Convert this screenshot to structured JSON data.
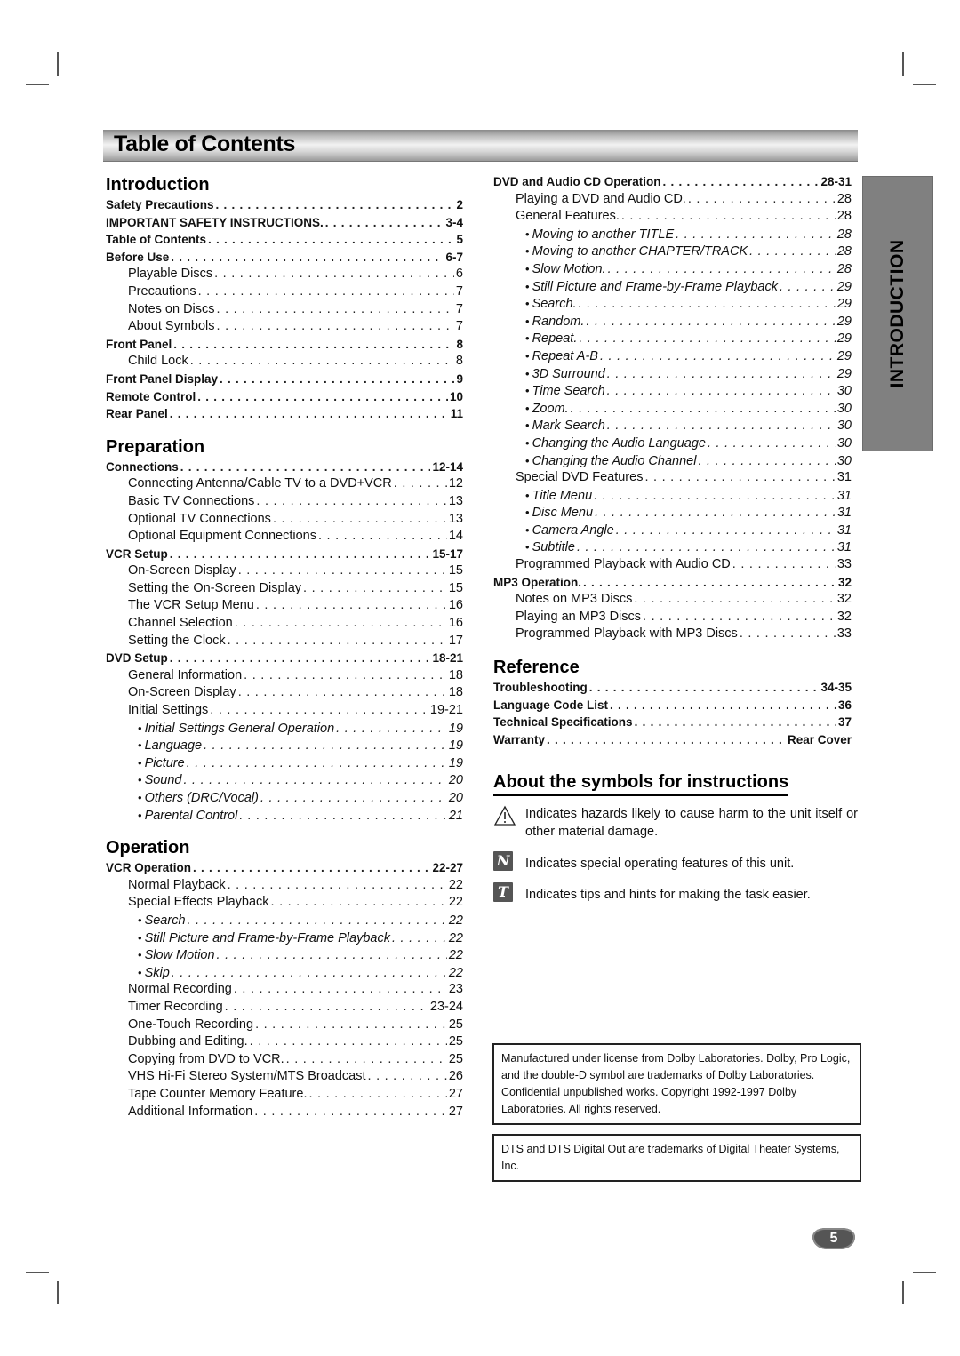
{
  "header": {
    "title": "Table of Contents"
  },
  "side_tab": {
    "label": "INTRODUCTION"
  },
  "left_column": [
    {
      "heading": "Introduction",
      "entries": [
        {
          "level": 1,
          "label": "Safety Precautions",
          "page": "2"
        },
        {
          "level": 1,
          "label": "IMPORTANT SAFETY INSTRUCTIONS.",
          "page": "3-4"
        },
        {
          "level": 1,
          "label": "Table of Contents",
          "page": "5"
        },
        {
          "level": 1,
          "label": "Before Use",
          "page": "6-7"
        },
        {
          "level": 2,
          "label": "Playable Discs",
          "page": "6"
        },
        {
          "level": 2,
          "label": "Precautions",
          "page": "7"
        },
        {
          "level": 2,
          "label": "Notes on Discs",
          "page": "7"
        },
        {
          "level": 2,
          "label": "About Symbols",
          "page": "7"
        },
        {
          "level": 1,
          "label": "Front Panel",
          "page": "8"
        },
        {
          "level": 2,
          "label": "Child Lock",
          "page": "8"
        },
        {
          "level": 1,
          "label": "Front Panel Display",
          "page": "9"
        },
        {
          "level": 1,
          "label": "Remote Control",
          "page": "10"
        },
        {
          "level": 1,
          "label": "Rear Panel",
          "page": "11"
        }
      ]
    },
    {
      "heading": "Preparation",
      "entries": [
        {
          "level": 1,
          "label": "Connections",
          "page": "12-14"
        },
        {
          "level": 2,
          "label": "Connecting Antenna/Cable TV to a DVD+VCR",
          "page": "12"
        },
        {
          "level": 2,
          "label": "Basic TV Connections",
          "page": "13"
        },
        {
          "level": 2,
          "label": "Optional TV Connections",
          "page": "13"
        },
        {
          "level": 2,
          "label": "Optional Equipment Connections",
          "page": "14"
        },
        {
          "level": 1,
          "label": "VCR Setup",
          "page": "15-17"
        },
        {
          "level": 2,
          "label": "On-Screen Display",
          "page": "15"
        },
        {
          "level": 2,
          "label": "Setting the On-Screen Display",
          "page": "15"
        },
        {
          "level": 2,
          "label": "The VCR Setup Menu",
          "page": "16"
        },
        {
          "level": 2,
          "label": "Channel Selection",
          "page": "16"
        },
        {
          "level": 2,
          "label": "Setting the Clock",
          "page": "17"
        },
        {
          "level": 1,
          "label": "DVD Setup",
          "page": "18-21"
        },
        {
          "level": 2,
          "label": "General Information",
          "page": "18"
        },
        {
          "level": 2,
          "label": "On-Screen Display",
          "page": "18"
        },
        {
          "level": 2,
          "label": "Initial Settings",
          "page": "19-21"
        },
        {
          "level": 3,
          "label": "Initial Settings General Operation",
          "page": "19"
        },
        {
          "level": 3,
          "label": "Language",
          "page": "19"
        },
        {
          "level": 3,
          "label": "Picture",
          "page": "19"
        },
        {
          "level": 3,
          "label": "Sound",
          "page": "20"
        },
        {
          "level": 3,
          "label": "Others (DRC/Vocal)",
          "page": "20"
        },
        {
          "level": 3,
          "label": "Parental Control",
          "page": "21"
        }
      ]
    },
    {
      "heading": "Operation",
      "entries": [
        {
          "level": 1,
          "label": "VCR Operation",
          "page": "22-27"
        },
        {
          "level": 2,
          "label": "Normal Playback",
          "page": "22"
        },
        {
          "level": 2,
          "label": "Special Effects Playback",
          "page": "22"
        },
        {
          "level": 3,
          "label": "Search",
          "page": "22"
        },
        {
          "level": 3,
          "label": "Still Picture and Frame-by-Frame Playback",
          "page": "22"
        },
        {
          "level": 3,
          "label": "Slow Motion",
          "page": "22"
        },
        {
          "level": 3,
          "label": "Skip",
          "page": "22"
        },
        {
          "level": 2,
          "label": "Normal Recording",
          "page": "23"
        },
        {
          "level": 2,
          "label": "Timer Recording",
          "page": "23-24"
        },
        {
          "level": 2,
          "label": "One-Touch Recording",
          "page": "25"
        },
        {
          "level": 2,
          "label": "Dubbing and Editing.",
          "page": "25"
        },
        {
          "level": 2,
          "label": "Copying from DVD to VCR.",
          "page": "25"
        },
        {
          "level": 2,
          "label": "VHS Hi-Fi Stereo System/MTS Broadcast",
          "page": "26"
        },
        {
          "level": 2,
          "label": "Tape Counter Memory Feature.",
          "page": "27"
        },
        {
          "level": 2,
          "label": "Additional Information",
          "page": "27"
        }
      ]
    }
  ],
  "right_column": [
    {
      "heading": "",
      "entries": [
        {
          "level": 1,
          "label": "DVD and Audio CD Operation",
          "page": "28-31"
        },
        {
          "level": 2,
          "label": "Playing a DVD and Audio CD.",
          "page": "28"
        },
        {
          "level": 2,
          "label": "General Features.",
          "page": "28"
        },
        {
          "level": 3,
          "label": "Moving to another TITLE",
          "page": "28"
        },
        {
          "level": 3,
          "label": "Moving to another CHAPTER/TRACK",
          "page": "28"
        },
        {
          "level": 3,
          "label": "Slow Motion.",
          "page": "28"
        },
        {
          "level": 3,
          "label": "Still Picture and Frame-by-Frame Playback",
          "page": "29"
        },
        {
          "level": 3,
          "label": "Search.",
          "page": "29"
        },
        {
          "level": 3,
          "label": "Random.",
          "page": "29"
        },
        {
          "level": 3,
          "label": "Repeat.",
          "page": "29"
        },
        {
          "level": 3,
          "label": "Repeat A-B",
          "page": "29"
        },
        {
          "level": 3,
          "label": "3D Surround",
          "page": "29"
        },
        {
          "level": 3,
          "label": "Time Search",
          "page": "30"
        },
        {
          "level": 3,
          "label": "Zoom.",
          "page": "30"
        },
        {
          "level": 3,
          "label": "Mark Search",
          "page": "30"
        },
        {
          "level": 3,
          "label": "Changing the Audio Language",
          "page": "30"
        },
        {
          "level": 3,
          "label": "Changing the Audio Channel",
          "page": "30"
        },
        {
          "level": 2,
          "label": "Special DVD Features",
          "page": "31"
        },
        {
          "level": 3,
          "label": "Title Menu",
          "page": "31"
        },
        {
          "level": 3,
          "label": "Disc Menu",
          "page": "31"
        },
        {
          "level": 3,
          "label": "Camera Angle",
          "page": "31"
        },
        {
          "level": 3,
          "label": "Subtitle",
          "page": "31"
        },
        {
          "level": 2,
          "label": "Programmed Playback with Audio CD",
          "page": "33"
        },
        {
          "level": 1,
          "label": "MP3 Operation.",
          "page": "32"
        },
        {
          "level": 2,
          "label": "Notes on MP3 Discs",
          "page": "32"
        },
        {
          "level": 2,
          "label": "Playing an MP3 Discs",
          "page": "32"
        },
        {
          "level": 2,
          "label": "Programmed Playback with MP3 Discs",
          "page": "33"
        }
      ]
    },
    {
      "heading": "Reference",
      "entries": [
        {
          "level": 1,
          "label": "Troubleshooting",
          "page": "34-35"
        },
        {
          "level": 1,
          "label": "Language Code List",
          "page": "36"
        },
        {
          "level": 1,
          "label": "Technical Specifications",
          "page": "37"
        },
        {
          "level": 1,
          "label": "Warranty",
          "page": "Rear Cover"
        }
      ]
    }
  ],
  "symbols": {
    "heading": "About the symbols for instructions",
    "items": [
      {
        "icon": "warning-triangle-icon",
        "glyph": "!",
        "text": "Indicates hazards likely to cause harm to the unit itself or other material damage."
      },
      {
        "icon": "note-n-icon",
        "glyph": "N",
        "text": "Indicates special operating features of this unit."
      },
      {
        "icon": "tip-t-icon",
        "glyph": "T",
        "text": "Indicates tips and hints for making the task easier."
      }
    ]
  },
  "legal": {
    "dolby": "Manufactured under license from Dolby Laboratories. Dolby, Pro Logic, and the double-D symbol are trademarks of Dolby Laboratories. Confidential unpublished works. Copyright 1992-1997 Dolby Laboratories. All rights reserved.",
    "dts": "DTS and DTS Digital Out are trademarks of Digital Theater Systems, Inc."
  },
  "page_number": "5"
}
